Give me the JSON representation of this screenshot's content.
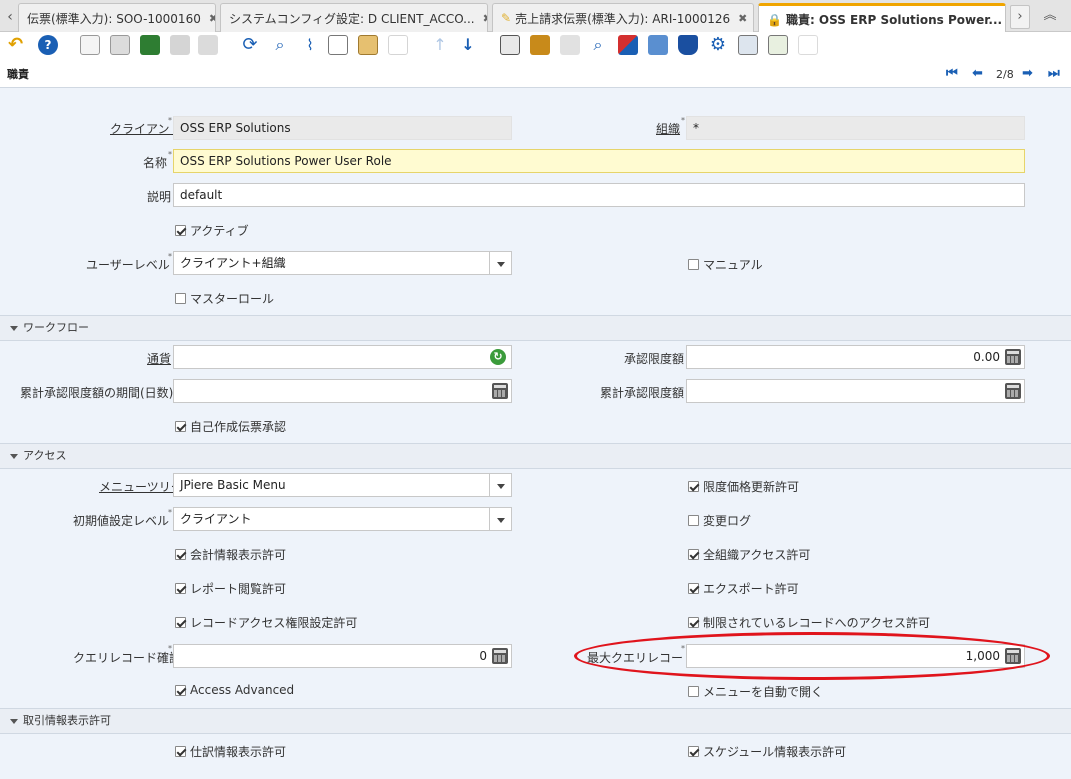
{
  "tabs": [
    {
      "label": "伝票(標準入力): SOO-1000160",
      "icon": ""
    },
    {
      "label": "システムコンフィグ設定: D CLIENT_ACCO...",
      "icon": ""
    },
    {
      "label": "売上請求伝票(標準入力): ARI-1000126",
      "icon": "note-icon"
    },
    {
      "label": "職責: OSS ERP Solutions Power...",
      "icon": "lock-icon"
    }
  ],
  "header": {
    "title": "職責",
    "record_counter": "2/8"
  },
  "fields": {
    "client_label": "クライアント",
    "client_value": "OSS ERP Solutions",
    "org_label": "組織",
    "org_value": "*",
    "name_label": "名称",
    "name_value": "OSS ERP Solutions Power User Role",
    "desc_label": "説明",
    "desc_value": "default",
    "active_label": "アクティブ",
    "user_level_label": "ユーザーレベル",
    "user_level_value": "クライアント+組織",
    "manual_label": "マニュアル",
    "master_role_label": "マスターロール"
  },
  "workflow": {
    "section_label": "ワークフロー",
    "currency_label": "通貨",
    "currency_value": "",
    "approval_amount_label": "承認限度額",
    "approval_amount_value": "0.00",
    "accum_period_label": "累計承認限度額の期間(日数)",
    "accum_period_value": "",
    "accum_amount_label": "累計承認限度額",
    "accum_amount_value": "",
    "self_approve_label": "自己作成伝票承認"
  },
  "access": {
    "section_label": "アクセス",
    "menu_tree_label": "メニューツリー",
    "menu_tree_value": "JPiere Basic Menu",
    "price_limit_label": "限度価格更新許可",
    "init_level_label": "初期値設定レベル",
    "init_level_value": "クライアント",
    "change_log_label": "変更ログ",
    "show_acct_label": "会計情報表示許可",
    "all_orgs_label": "全組織アクセス許可",
    "report_view_label": "レポート閲覧許可",
    "export_label": "エクスポート許可",
    "record_access_label": "レコードアクセス権限設定許可",
    "restricted_access_label": "制限されているレコードへのアクセス許可",
    "confirm_query_label": "クエリレコード確認",
    "confirm_query_value": "0",
    "max_query_label": "最大クエリレコード",
    "max_query_value": "1,000",
    "access_advanced_label": "Access Advanced",
    "auto_expand_label": "メニューを自動で開く"
  },
  "trx": {
    "section_label": "取引情報表示許可",
    "journal_label": "仕訳情報表示許可",
    "schedule_label": "スケジュール情報表示許可"
  },
  "colors": {
    "accent": "#f0a500",
    "highlight": "#e0141c",
    "nav": "#1a5fb4"
  }
}
